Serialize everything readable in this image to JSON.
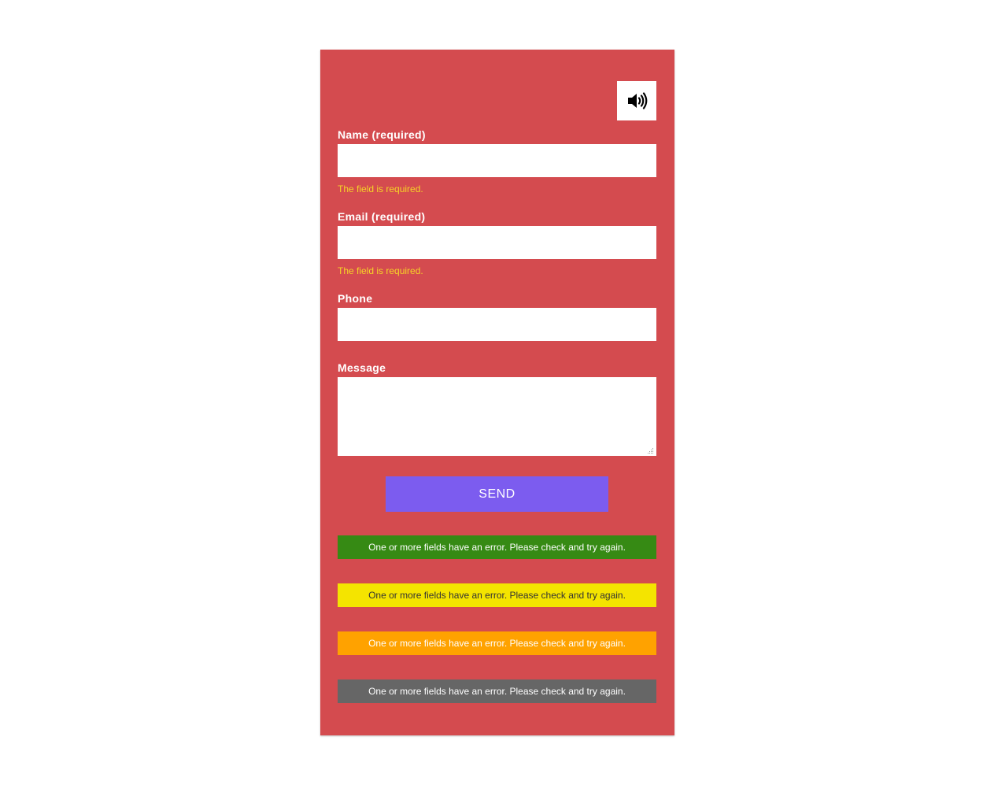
{
  "colors": {
    "panel_bg": "#d44b4f",
    "send_bg": "#7c5cef",
    "error_text": "#f5d327",
    "alert_green": "#368a14",
    "alert_yellow": "#f4e400",
    "alert_orange": "#ffa200",
    "alert_gray": "#666666"
  },
  "audio_button": {
    "icon": "speaker-volume-icon"
  },
  "form": {
    "name": {
      "label": "Name (required)",
      "value": "",
      "error": "The field is required."
    },
    "email": {
      "label": "Email (required)",
      "value": "",
      "error": "The field is required."
    },
    "phone": {
      "label": "Phone",
      "value": ""
    },
    "message": {
      "label": "Message",
      "value": ""
    },
    "send_label": "SEND"
  },
  "alerts": [
    {
      "text": "One or more fields have an error. Please check and try again.",
      "bg": "#368a14",
      "color": "#ffffff"
    },
    {
      "text": "One or more fields have an error. Please check and try again.",
      "bg": "#f4e400",
      "color": "#333333"
    },
    {
      "text": "One or more fields have an error. Please check and try again.",
      "bg": "#ffa200",
      "color": "#ffffff"
    },
    {
      "text": "One or more fields have an error. Please check and try again.",
      "bg": "#666666",
      "color": "#ffffff"
    }
  ]
}
